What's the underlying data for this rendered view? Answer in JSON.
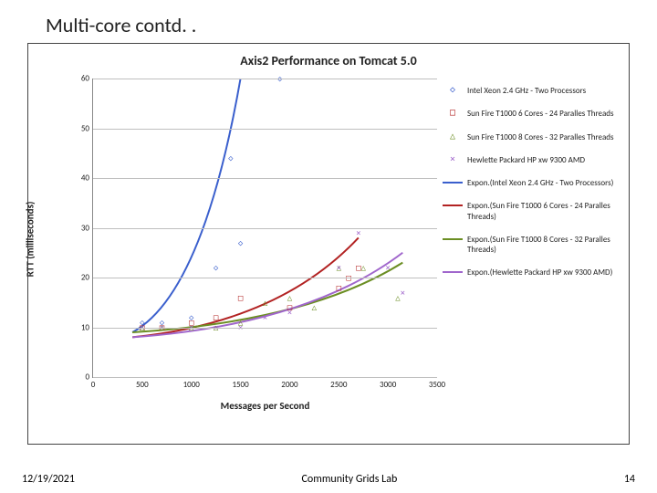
{
  "slide_title": "Multi-core contd. .",
  "footer": {
    "date": "12/19/2021",
    "center": "Community Grids Lab",
    "page": "14"
  },
  "chart_data": {
    "type": "scatter",
    "title": "Axis2 Performance on Tomcat 5.0",
    "xlabel": "Messages per Second",
    "ylabel": "RTT (milliseconds)",
    "xlim": [
      0,
      3500
    ],
    "ylim": [
      0,
      60
    ],
    "xticks": [
      0,
      500,
      1000,
      1500,
      2000,
      2500,
      3000,
      3500
    ],
    "yticks": [
      0,
      10,
      20,
      30,
      40,
      50,
      60
    ],
    "legend": [
      {
        "name": "Intel Xeon 2.4 GHz - Two Processors",
        "kind": "marker",
        "color": "#3a5fcd",
        "symbol": "◇"
      },
      {
        "name": "Sun Fire T1000 6 Cores - 24 Paralles Threads",
        "kind": "marker",
        "color": "#b22222",
        "symbol": "□"
      },
      {
        "name": "Sun Fire T1000 8 Cores - 32 Paralles Threads",
        "kind": "marker",
        "color": "#6b8e23",
        "symbol": "△"
      },
      {
        "name": "Hewlette Packard HP xw 9300 AMD",
        "kind": "marker",
        "color": "#a066cc",
        "symbol": "×"
      },
      {
        "name": "Expon.(Intel Xeon 2.4 GHz - Two Processors)",
        "kind": "line",
        "color": "#3a5fcd"
      },
      {
        "name": "Expon.(Sun Fire T1000 6 Cores - 24 Paralles Threads)",
        "kind": "line",
        "color": "#b22222"
      },
      {
        "name": "Expon.(Sun Fire T1000 8 Cores - 32 Paralles Threads)",
        "kind": "line",
        "color": "#6b8e23"
      },
      {
        "name": "Expon.(Hewlette Packard HP xw 9300 AMD)",
        "kind": "line",
        "color": "#a066cc"
      }
    ],
    "series": [
      {
        "name": "Intel Xeon 2.4 GHz - Two Processors",
        "marker": "◇",
        "color": "#3a5fcd",
        "x": [
          500,
          700,
          1000,
          1250,
          1400,
          1500,
          1900
        ],
        "y": [
          11,
          11,
          12,
          22,
          44,
          27,
          60
        ]
      },
      {
        "name": "Sun Fire T1000 6 Cores - 24 Paralles Threads",
        "marker": "□",
        "color": "#b22222",
        "x": [
          500,
          700,
          1000,
          1250,
          1500,
          2000,
          2500,
          2600,
          2700
        ],
        "y": [
          10,
          10,
          11,
          12,
          16,
          14,
          18,
          20,
          22
        ]
      },
      {
        "name": "Sun Fire T1000 8 Cores - 32 Paralles Threads",
        "marker": "△",
        "color": "#6b8e23",
        "x": [
          500,
          700,
          1000,
          1250,
          1500,
          1750,
          2000,
          2250,
          2500,
          2750,
          3100
        ],
        "y": [
          10,
          10,
          10,
          10,
          11,
          15,
          16,
          14,
          22,
          22,
          16
        ]
      },
      {
        "name": "Hewlette Packard HP xw 9300 AMD",
        "marker": "×",
        "color": "#a066cc",
        "x": [
          500,
          700,
          1000,
          1250,
          1500,
          1750,
          2000,
          2500,
          2700,
          3000,
          3150
        ],
        "y": [
          10,
          10,
          10,
          10,
          10,
          12,
          13,
          22,
          29,
          22,
          17
        ]
      }
    ],
    "trendlines": [
      {
        "name": "Expon.(Intel Xeon 2.4 GHz - Two Processors)",
        "color": "#3a5fcd",
        "x0": 400,
        "y0": 9,
        "x1": 1500,
        "y1": 60
      },
      {
        "name": "Expon.(Sun Fire T1000 6 Cores - 24 Paralles Threads)",
        "color": "#b22222",
        "x0": 400,
        "y0": 8,
        "x1": 2700,
        "y1": 28
      },
      {
        "name": "Expon.(Sun Fire T1000 8 Cores - 32 Paralles Threads)",
        "color": "#6b8e23",
        "x0": 400,
        "y0": 9,
        "x1": 3150,
        "y1": 23
      },
      {
        "name": "Expon.(Hewlette Packard HP xw 9300 AMD)",
        "color": "#a066cc",
        "x0": 400,
        "y0": 8,
        "x1": 3150,
        "y1": 25
      }
    ]
  }
}
